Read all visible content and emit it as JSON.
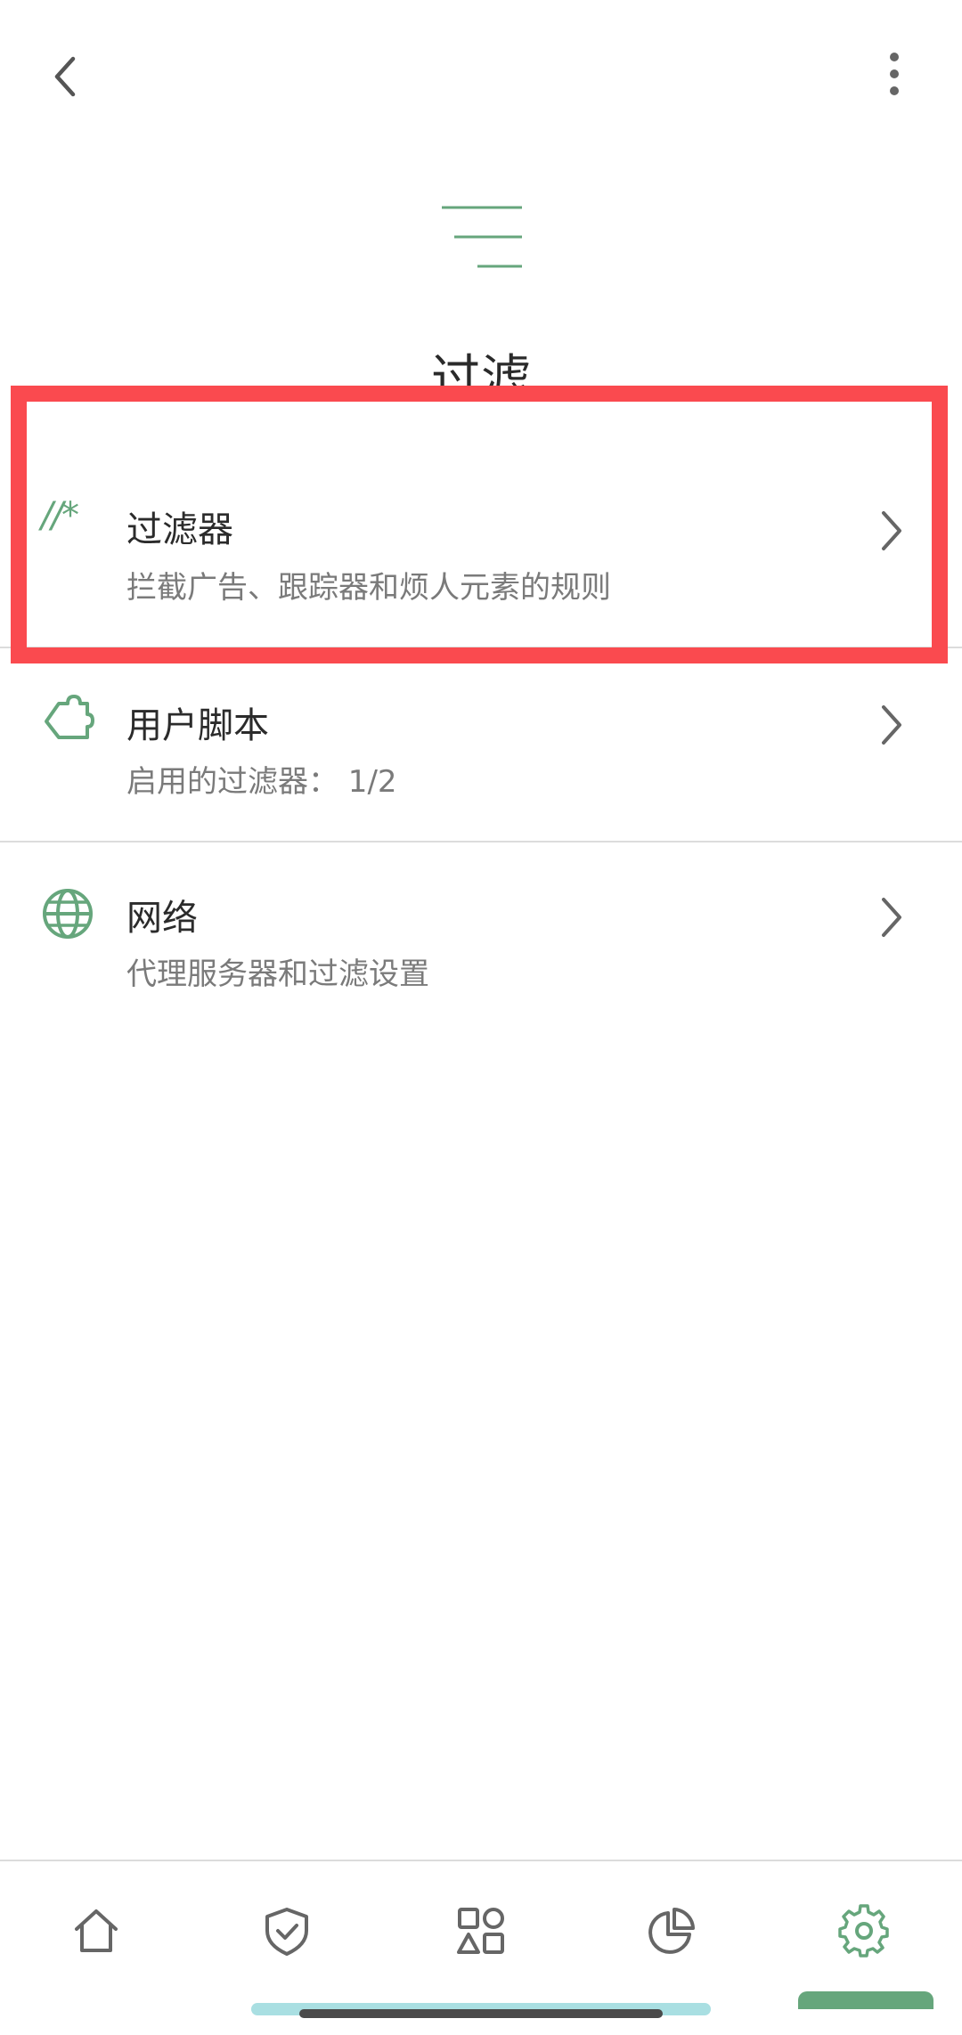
{
  "page": {
    "title": "过滤"
  },
  "items": [
    {
      "title": "过滤器",
      "subtitle": "拦截广告、跟踪器和烦人元素的规则",
      "icon": "filter-rules-icon"
    },
    {
      "title": "用户脚本",
      "subtitle": "启用的过滤器： 1/2",
      "icon": "puzzle-icon"
    },
    {
      "title": "网络",
      "subtitle": "代理服务器和过滤设置",
      "icon": "globe-icon"
    }
  ],
  "filter_icon_text": "//*",
  "nav": {
    "items": [
      "home-icon",
      "shield-check-icon",
      "apps-icon",
      "stats-pie-icon",
      "settings-gear-icon"
    ],
    "active": "settings-gear-icon"
  },
  "colors": {
    "accent": "#66a67c",
    "highlight": "#fa4a4f",
    "text": "#2b2b2b",
    "subtext": "#7a7a7a"
  }
}
